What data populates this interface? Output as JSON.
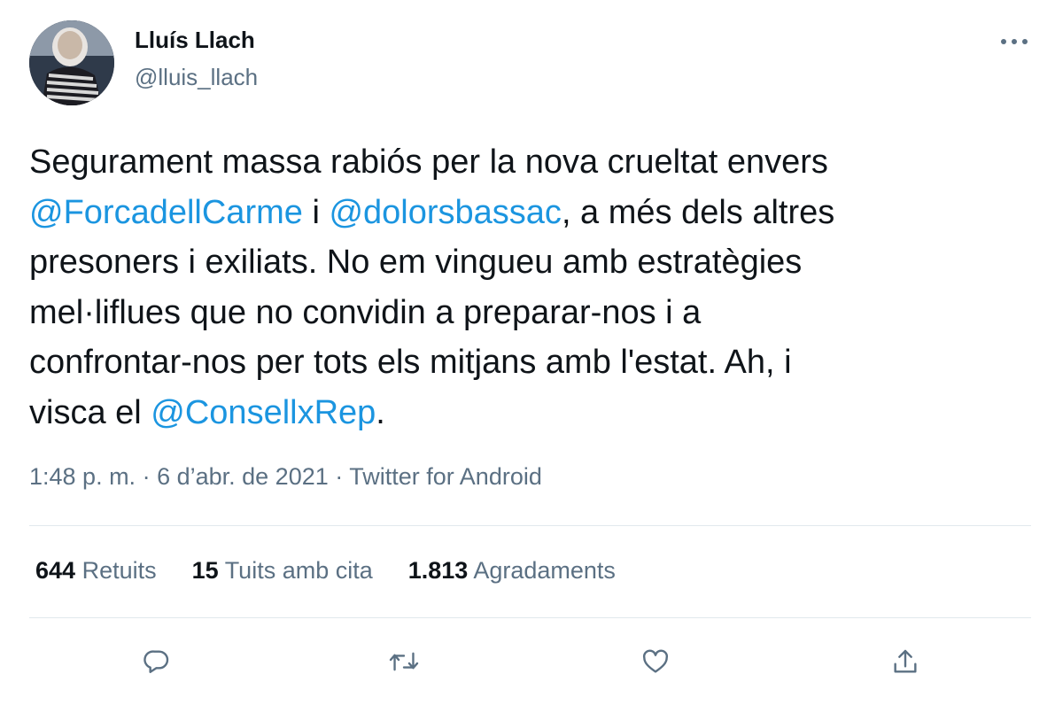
{
  "user": {
    "display_name": "Lluís Llach",
    "handle": "@lluis_llach"
  },
  "tweet": {
    "lines": [
      [
        {
          "t": "Segurament massa rabiós per la nova crueltat envers",
          "m": false
        }
      ],
      [
        {
          "t": "@ForcadellCarme",
          "m": true
        },
        {
          "t": " i ",
          "m": false
        },
        {
          "t": "@dolorsbassac",
          "m": true
        },
        {
          "t": ", a més dels altres",
          "m": false
        }
      ],
      [
        {
          "t": "presoners i exiliats. No em vingueu amb estratègies",
          "m": false
        }
      ],
      [
        {
          "t": "mel·liflues que no convidin a preparar-nos i a",
          "m": false
        }
      ],
      [
        {
          "t": "confrontar-nos per tots els mitjans amb l'estat. Ah, i",
          "m": false
        }
      ],
      [
        {
          "t": "visca el ",
          "m": false
        },
        {
          "t": "@ConsellxRep",
          "m": true
        },
        {
          "t": ".",
          "m": false
        }
      ]
    ],
    "time": "1:48 p. m.",
    "separator": " · ",
    "date": "6 d’abr. de 2021",
    "source": "Twitter for Android"
  },
  "stats": {
    "retweets": {
      "count": "644",
      "label": "Retuits"
    },
    "quotes": {
      "count": "15",
      "label": "Tuits amb cita"
    },
    "likes": {
      "count": "1.813",
      "label": "Agradaments"
    }
  },
  "actions": [
    "reply-icon",
    "retweet-icon",
    "like-icon",
    "share-icon"
  ],
  "colors": {
    "text": "#0f1419",
    "secondary": "#5b7083",
    "link": "#1b95e0",
    "divider": "#e1e8ed"
  }
}
